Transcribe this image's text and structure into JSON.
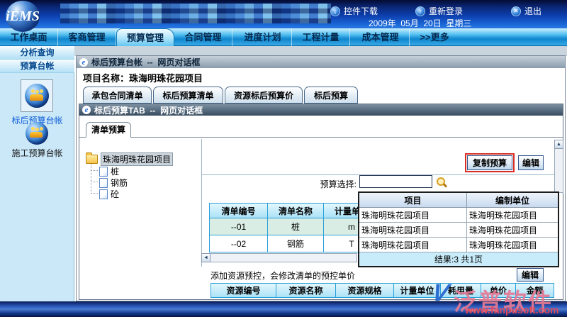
{
  "header": {
    "logo_text": "iEMS",
    "links": [
      {
        "label": "控件下载",
        "glyph": "↓"
      },
      {
        "label": "重新登录",
        "glyph": "↑"
      },
      {
        "label": "退出",
        "glyph": "✕"
      }
    ],
    "date": "2009年  05月  20日  星期三"
  },
  "nav": {
    "tabs": [
      {
        "label": "工作桌面",
        "active": false
      },
      {
        "label": "客商管理",
        "active": false
      },
      {
        "label": "预算管理",
        "active": true
      },
      {
        "label": "合同管理",
        "active": false
      },
      {
        "label": "进度计划",
        "active": false
      },
      {
        "label": "工程计量",
        "active": false
      },
      {
        "label": "成本管理",
        "active": false
      },
      {
        "label": ">>更多",
        "active": false
      }
    ]
  },
  "sidebar": {
    "sections": [
      {
        "label": "分析查询"
      },
      {
        "label": "预算台帐"
      }
    ],
    "items": [
      {
        "label": "标后预算台帐",
        "selected": true
      },
      {
        "label": "施工预算台帐",
        "selected": false
      }
    ]
  },
  "outer_dialog": {
    "title": "标后预算台帐  --  网页对话框",
    "project_label": "项目名称：珠海明珠花园项目",
    "tabs": [
      {
        "label": "承包合同清单"
      },
      {
        "label": "标后预算清单"
      },
      {
        "label": "资源标后预算价"
      },
      {
        "label": "标后预算"
      }
    ]
  },
  "inner_dialog": {
    "title": "标后预算TAB  --  网页对话框",
    "tab": "清单预算",
    "tree": {
      "root": "珠海明珠花园项目",
      "children": [
        "桩",
        "钢筋",
        "砼"
      ]
    },
    "copy_button": "复制预算",
    "edit_button": "编辑",
    "budget_select_label": "预算选择:",
    "budget_select_value": "",
    "list_table": {
      "headers": [
        "清单编号",
        "清单名称",
        "计量单位"
      ],
      "rows": [
        [
          "--01",
          "桩",
          "m"
        ],
        [
          "--02",
          "钢筋",
          "T"
        ]
      ]
    },
    "popup": {
      "headers": [
        "项目",
        "编制单位"
      ],
      "rows": [
        [
          "珠海明珠花园项目",
          "珠海明珠花园项目"
        ],
        [
          "珠海明珠花园项目",
          "珠海明珠花园项目"
        ],
        [
          "珠海明珠花园项目",
          "珠海明珠花园项目"
        ]
      ],
      "footer": "结果:3 共1页"
    },
    "resource_note": "添加资源预控，会修改清单的预控单价",
    "resource_edit_button": "编辑",
    "resource_table": {
      "headers": [
        "资源编号",
        "资源名称",
        "资源规格",
        "计量单位",
        "耗用量",
        "单价",
        "金额"
      ]
    }
  },
  "watermark": {
    "logo_glyph": "V",
    "brand": "泛普软件",
    "url": "www.fanpusoft.com"
  },
  "colors": {
    "accent_blue": "#1e90d6",
    "highlight_red": "#d93025",
    "watermark_pink": "#e47a94"
  }
}
